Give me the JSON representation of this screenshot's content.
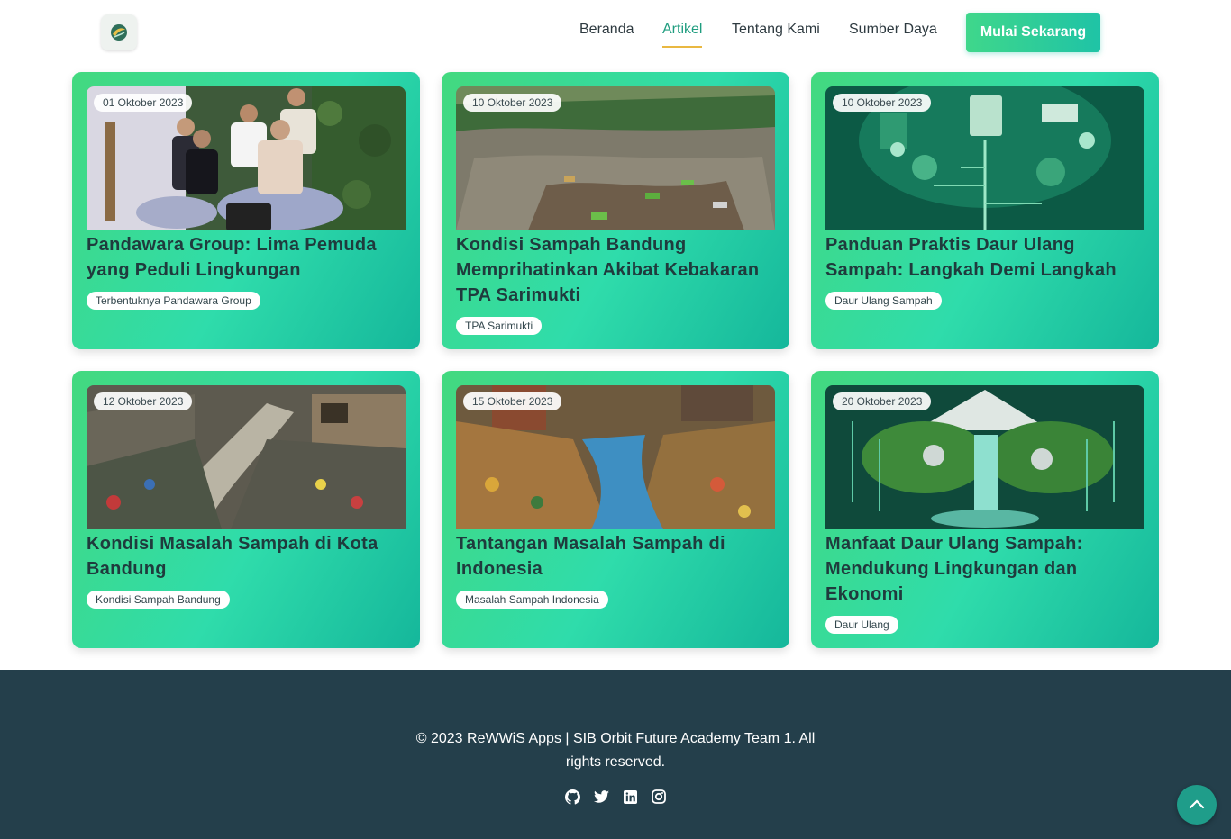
{
  "header": {
    "logo_icon": "leaf-recycle-logo-icon",
    "nav": [
      {
        "label": "Beranda",
        "active": false
      },
      {
        "label": "Artikel",
        "active": true
      },
      {
        "label": "Tentang Kami",
        "active": false
      },
      {
        "label": "Sumber Daya",
        "active": false
      }
    ],
    "cta_label": "Mulai Sekarang"
  },
  "articles": [
    {
      "date": "01 Oktober 2023",
      "title": "Pandawara Group: Lima Pemuda yang Peduli Lingkungan",
      "tag": "Terbentuknya Pandawara Group"
    },
    {
      "date": "10 Oktober 2023",
      "title": "Kondisi Sampah Bandung Memprihatinkan Akibat Kebakaran TPA Sarimukti",
      "tag": "TPA Sarimukti"
    },
    {
      "date": "10 Oktober 2023",
      "title": "Panduan Praktis Daur Ulang Sampah: Langkah Demi Langkah",
      "tag": "Daur Ulang Sampah"
    },
    {
      "date": "12 Oktober 2023",
      "title": "Kondisi Masalah Sampah di Kota Bandung",
      "tag": "Kondisi Sampah Bandung"
    },
    {
      "date": "15 Oktober 2023",
      "title": "Tantangan Masalah Sampah di Indonesia",
      "tag": "Masalah Sampah Indonesia"
    },
    {
      "date": "20 Oktober 2023",
      "title": "Manfaat Daur Ulang Sampah: Mendukung Lingkungan dan Ekonomi",
      "tag": "Daur Ulang"
    }
  ],
  "footer": {
    "copyright": "© 2023 ReWWiS Apps | SIB Orbit Future Academy Team 1. All rights reserved.",
    "social_icons": [
      "github-icon",
      "twitter-icon",
      "linkedin-icon",
      "instagram-icon"
    ]
  },
  "colors": {
    "accent": "#1f9d7f",
    "card_gradient_start": "#43d97f",
    "card_gradient_end": "#15b79b",
    "footer_bg": "#243f4b",
    "active_underline": "#e9b841"
  }
}
